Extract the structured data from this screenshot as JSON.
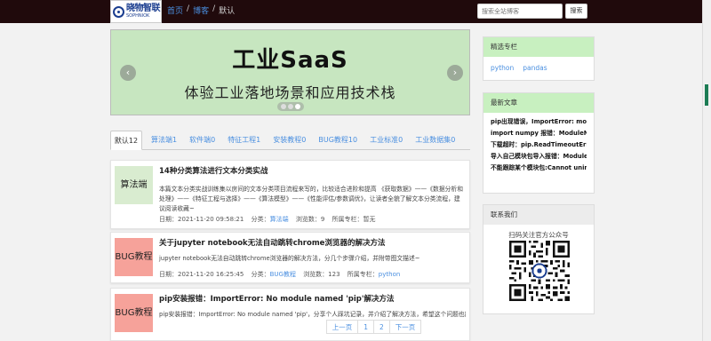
{
  "header": {
    "logo_cn": "晓物智联",
    "logo_en": "SOPHNIOK",
    "breadcrumbs": [
      "首页",
      "博客",
      "默认"
    ],
    "separator": "/",
    "search_placeholder": "搜索全站博客",
    "search_button": "搜索"
  },
  "banner": {
    "title": "工业SaaS",
    "subtitle": "体验工业落地场景和应用技术栈",
    "prev": "‹",
    "next": "›"
  },
  "tabs": [
    {
      "label": "默认12"
    },
    {
      "label": "算法端1"
    },
    {
      "label": "软件端0"
    },
    {
      "label": "特征工程1"
    },
    {
      "label": "安装教程0"
    },
    {
      "label": "BUG教程10"
    },
    {
      "label": "工业标准0"
    },
    {
      "label": "工业数据集0"
    }
  ],
  "articles": [
    {
      "thumb_label": "算法端",
      "thumb_color": "#d9ecd0",
      "title": "14种分类算法进行文本分类实战",
      "desc": "本篇文本分类实战训练集以房间的文本分类项目流程来写的，比较适合进阶和提高 《获取数据》——《数据分析和处理》——《特征工程与选择》——《算法模型》——《性能评估/参数调优》，让读者全貌了解文本分类流程，建议阅读收藏~",
      "meta_date": "日期：2021-11-20 09:58:21",
      "meta_cat_label": "分类：",
      "meta_cat": "算法端",
      "meta_views": "浏览数：9",
      "meta_col_label": "所属专栏：",
      "meta_col": "暂无"
    },
    {
      "thumb_label": "BUG教程",
      "thumb_color": "#f6a29a",
      "title": "关于jupyter notebook无法自动跳转chrome浏览器的解决方法",
      "desc": "jupyter notebook无法自动跳转chrome浏览器的解决方法，分几个步骤介绍，并附带图文描述~",
      "meta_date": "日期：2021-11-20 16:25:45",
      "meta_cat_label": "分类：",
      "meta_cat": "BUG教程",
      "meta_views": "浏览数：123",
      "meta_col_label": "所属专栏：",
      "meta_col": "python"
    },
    {
      "thumb_label": "BUG教程",
      "thumb_color": "#f6a29a",
      "title": "pip安装报错：ImportError: No module named 'pip'解决方法",
      "desc": "pip安装报错：ImportError: No module named 'pip'，分享个人踩坑记录，并介绍了解决方法，希望这个问题也能帮"
    }
  ],
  "sidebar": {
    "featured_title": "精选专栏",
    "featured_tags": [
      "python",
      "pandas"
    ],
    "recent_title": "最新文章",
    "recent_items": [
      "pip出现错误，ImportError: module",
      "import numpy 报错：ModuleNotFo",
      "下载超时：pip.ReadTimeoutError:H",
      "导入自己模块包导入报错：ModuleN",
      "不能跟踪某个模块包:Cannot uninsta"
    ],
    "contact_title": "联系我们",
    "contact_text": "扫码关注官方公众号"
  },
  "pagination": [
    "上一页",
    "1",
    "2",
    "下一页"
  ]
}
